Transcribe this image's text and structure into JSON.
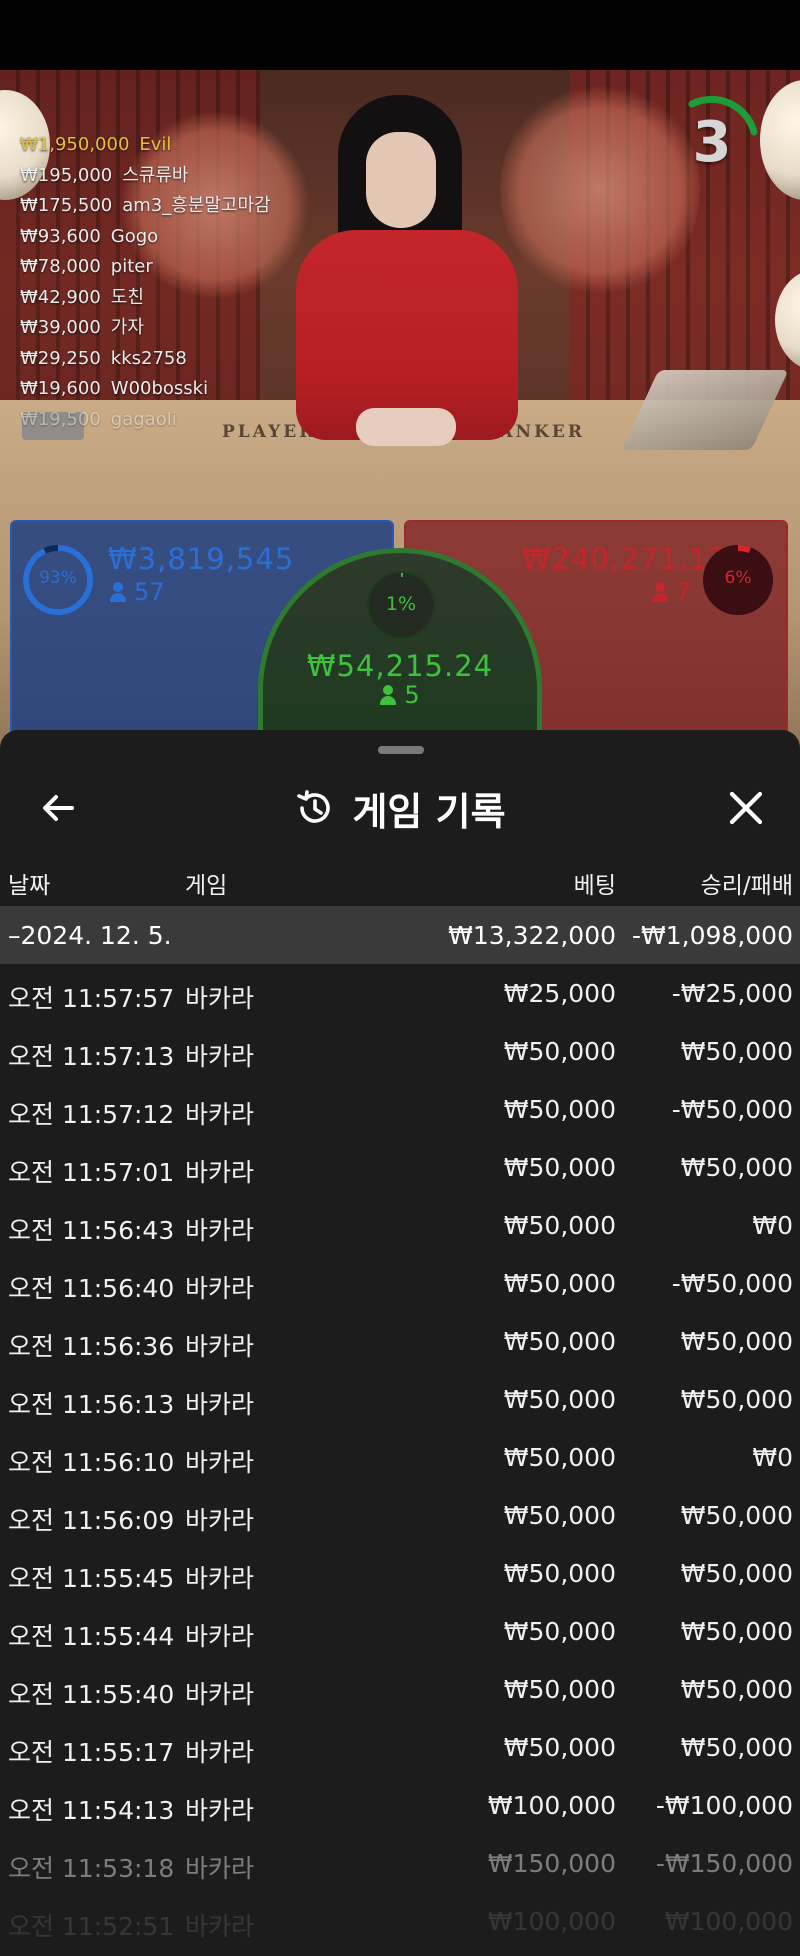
{
  "live": {
    "countdown": "3",
    "table_labels": {
      "player": "PLAYER",
      "banker": "BANKER"
    },
    "leaderboard": [
      {
        "amount": "₩1,950,000",
        "name": "Evil"
      },
      {
        "amount": "₩195,000",
        "name": "스큐류바"
      },
      {
        "amount": "₩175,500",
        "name": "am3_흥분말고마감"
      },
      {
        "amount": "₩93,600",
        "name": "Gogo"
      },
      {
        "amount": "₩78,000",
        "name": "piter"
      },
      {
        "amount": "₩42,900",
        "name": "도친"
      },
      {
        "amount": "₩39,000",
        "name": "가자"
      },
      {
        "amount": "₩29,250",
        "name": "kks2758"
      },
      {
        "amount": "₩19,600",
        "name": "W00bosski"
      },
      {
        "amount": "₩19,500",
        "name": "gagaoli"
      }
    ],
    "player": {
      "percent": "93%",
      "percent_value": 93,
      "amount": "₩3,819,545",
      "users": "57"
    },
    "banker": {
      "percent": "6%",
      "percent_value": 6,
      "amount": "₩240,271.12",
      "users": "7"
    },
    "tie": {
      "percent": "1%",
      "percent_value": 1,
      "amount": "₩54,215.24",
      "users": "5"
    },
    "colors": {
      "player": "#2a6fd6",
      "banker": "#d3262f",
      "tie": "#3ec23e",
      "top_bettor": "#e2c23a"
    }
  },
  "history": {
    "title": "게임 기록",
    "icons": {
      "back": "back-arrow-icon",
      "history": "history-clock-icon",
      "close": "close-icon"
    },
    "columns": {
      "date": "날짜",
      "game": "게임",
      "bet": "베팅",
      "result": "승리/패배"
    },
    "date_group": {
      "date": "–2024. 12. 5.",
      "bet_total": "₩13,322,000",
      "result_total": "-₩1,098,000"
    },
    "rows": [
      {
        "time": "오전 11:57:57",
        "game": "바카라",
        "bet": "₩25,000",
        "result": "-₩25,000"
      },
      {
        "time": "오전 11:57:13",
        "game": "바카라",
        "bet": "₩50,000",
        "result": "₩50,000"
      },
      {
        "time": "오전 11:57:12",
        "game": "바카라",
        "bet": "₩50,000",
        "result": "-₩50,000"
      },
      {
        "time": "오전 11:57:01",
        "game": "바카라",
        "bet": "₩50,000",
        "result": "₩50,000"
      },
      {
        "time": "오전 11:56:43",
        "game": "바카라",
        "bet": "₩50,000",
        "result": "₩0"
      },
      {
        "time": "오전 11:56:40",
        "game": "바카라",
        "bet": "₩50,000",
        "result": "-₩50,000"
      },
      {
        "time": "오전 11:56:36",
        "game": "바카라",
        "bet": "₩50,000",
        "result": "₩50,000"
      },
      {
        "time": "오전 11:56:13",
        "game": "바카라",
        "bet": "₩50,000",
        "result": "₩50,000"
      },
      {
        "time": "오전 11:56:10",
        "game": "바카라",
        "bet": "₩50,000",
        "result": "₩0"
      },
      {
        "time": "오전 11:56:09",
        "game": "바카라",
        "bet": "₩50,000",
        "result": "₩50,000"
      },
      {
        "time": "오전 11:55:45",
        "game": "바카라",
        "bet": "₩50,000",
        "result": "₩50,000"
      },
      {
        "time": "오전 11:55:44",
        "game": "바카라",
        "bet": "₩50,000",
        "result": "₩50,000"
      },
      {
        "time": "오전 11:55:40",
        "game": "바카라",
        "bet": "₩50,000",
        "result": "₩50,000"
      },
      {
        "time": "오전 11:55:17",
        "game": "바카라",
        "bet": "₩50,000",
        "result": "₩50,000"
      },
      {
        "time": "오전 11:54:13",
        "game": "바카라",
        "bet": "₩100,000",
        "result": "-₩100,000"
      },
      {
        "time": "오전 11:53:18",
        "game": "바카라",
        "bet": "₩150,000",
        "result": "-₩150,000"
      },
      {
        "time": "오전 11:52:51",
        "game": "바카라",
        "bet": "₩100,000",
        "result": "₩100,000"
      }
    ]
  }
}
